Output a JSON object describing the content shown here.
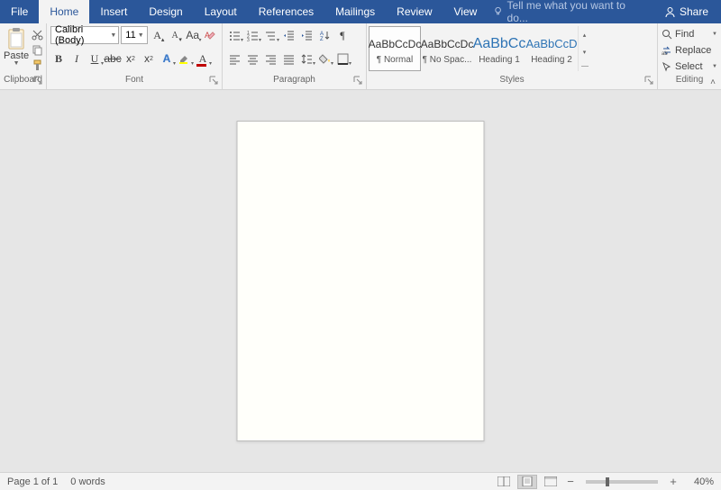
{
  "menu": {
    "tabs": [
      "File",
      "Home",
      "Insert",
      "Design",
      "Layout",
      "References",
      "Mailings",
      "Review",
      "View"
    ],
    "active": "Home",
    "tellme": "Tell me what you want to do...",
    "share": "Share"
  },
  "clipboard": {
    "paste": "Paste",
    "label": "Clipboard"
  },
  "font": {
    "name": "Calibri (Body)",
    "size": "11",
    "label": "Font"
  },
  "paragraph": {
    "label": "Paragraph"
  },
  "styles": {
    "label": "Styles",
    "items": [
      {
        "preview": "AaBbCcDc",
        "name": "¶ Normal",
        "blue": false,
        "selected": true
      },
      {
        "preview": "AaBbCcDc",
        "name": "¶ No Spac...",
        "blue": false,
        "selected": false
      },
      {
        "preview": "AaBbCc",
        "name": "Heading 1",
        "blue": true,
        "selected": false
      },
      {
        "preview": "AaBbCcD",
        "name": "Heading 2",
        "blue": true,
        "selected": false
      }
    ]
  },
  "editing": {
    "label": "Editing",
    "find": "Find",
    "replace": "Replace",
    "select": "Select"
  },
  "status": {
    "page": "Page 1 of 1",
    "words": "0 words",
    "zoom": "40%"
  }
}
